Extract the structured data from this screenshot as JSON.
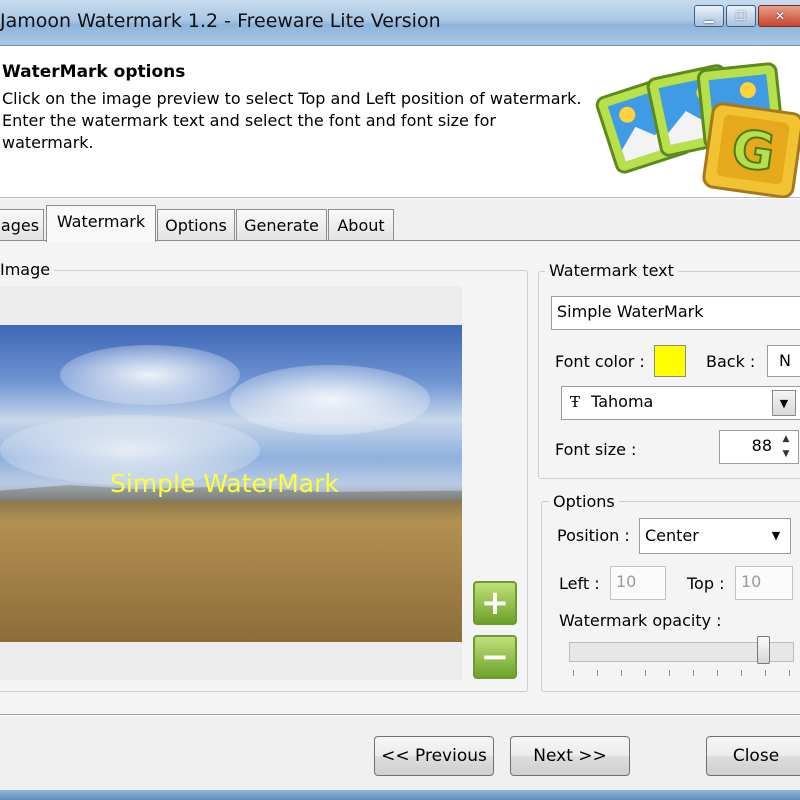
{
  "window": {
    "title": "Jamoon Watermark 1.2 - Freeware Lite Version",
    "controls": [
      "minimize",
      "maximize",
      "close"
    ]
  },
  "header": {
    "title": "WaterMark options",
    "description": "Click on the image preview to select Top and Left position of watermark. Enter the watermark text and select the font and font size for watermark.",
    "logo_icon": "jamoon-photo-stack-logo"
  },
  "tabs": [
    {
      "label": "ages",
      "active": false
    },
    {
      "label": "Watermark",
      "active": true
    },
    {
      "label": "Options",
      "active": false
    },
    {
      "label": "Generate",
      "active": false
    },
    {
      "label": "About",
      "active": false
    }
  ],
  "image_group": {
    "legend": "Image",
    "watermark_preview_text": "Simple WaterMark",
    "watermark_color": "#ffff33",
    "zoom_in_icon": "plus-icon",
    "zoom_out_icon": "minus-icon"
  },
  "watermark_text_group": {
    "legend": "Watermark text",
    "text_value": "Simple WaterMark",
    "font_color_label": "Font color :",
    "font_color": "#ffff00",
    "back_label": "Back :",
    "back_value": "N",
    "font_name": "Tahoma",
    "font_icon": "truetype-font-icon",
    "font_size_label": "Font size :",
    "font_size": "88"
  },
  "options_group": {
    "legend": "Options",
    "position_label": "Position :",
    "position_value": "Center",
    "left_label": "Left :",
    "left_value": "10",
    "top_label": "Top :",
    "top_value": "10",
    "opacity_label": "Watermark opacity :",
    "opacity_level": 0.9
  },
  "footer": {
    "previous_label": "<< Previous",
    "next_label": "Next >>",
    "close_label": "Close"
  }
}
